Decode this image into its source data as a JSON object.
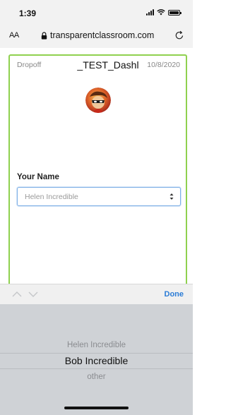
{
  "status_bar": {
    "time": "1:39"
  },
  "browser": {
    "text_size_label": "AA",
    "url": "transparentclassroom.com",
    "icons": [
      "lock-icon",
      "reload-icon"
    ]
  },
  "form": {
    "dropoff_label": "Dropoff",
    "class_name": "_TEST_Dashl",
    "date": "10/8/2020",
    "your_name_label": "Your Name",
    "name_select_value": "Helen Incredible",
    "border_color": "#8fd14f"
  },
  "accessory_bar": {
    "done_label": "Done",
    "accent_color": "#2b7cd6"
  },
  "picker": {
    "options": [
      "Helen Incredible",
      "Bob Incredible",
      "other"
    ],
    "selected": "Bob Incredible"
  }
}
